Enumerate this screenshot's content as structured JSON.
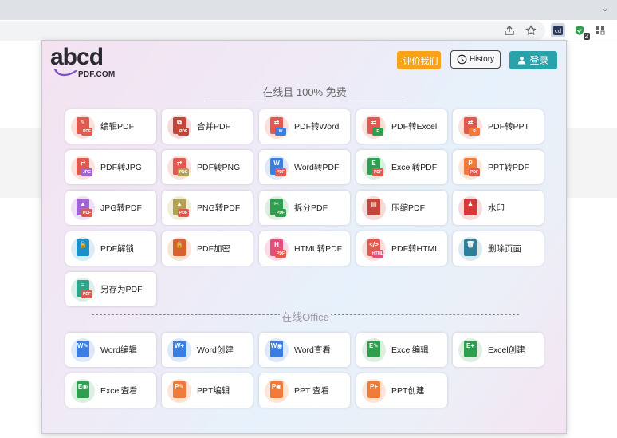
{
  "browser": {
    "extension_badge": "2"
  },
  "header": {
    "logo_text": "abcd",
    "logo_sub": "PDF.COM",
    "rate_label": "·评价我们",
    "history_label": "History",
    "login_label": "登录"
  },
  "tagline": "在线且 100% 免费",
  "office_section_label": "在线Office",
  "pdf_tools": [
    {
      "label": "编辑PDF",
      "icon": "edit-pdf-icon",
      "color": "#e05a4f",
      "tint": "#fbe0dc",
      "tag": "PDF",
      "glyph": "✎"
    },
    {
      "label": "合并PDF",
      "icon": "merge-pdf-icon",
      "color": "#c4453a",
      "tint": "#f6dcd9",
      "tag": "PDF",
      "glyph": "⧉"
    },
    {
      "label": "PDF转Word",
      "icon": "pdf-to-word-icon",
      "color": "#e05a4f",
      "tint": "#fbe0dc",
      "tag": "W",
      "tagColor": "#3b7de0",
      "glyph": "⇄"
    },
    {
      "label": "PDF转Excel",
      "icon": "pdf-to-excel-icon",
      "color": "#e05a4f",
      "tint": "#fbe0dc",
      "tag": "E",
      "tagColor": "#2e9e4f",
      "glyph": "⇄"
    },
    {
      "label": "PDF转PPT",
      "icon": "pdf-to-ppt-icon",
      "color": "#e05a4f",
      "tint": "#fbe0dc",
      "tag": "P",
      "tagColor": "#f07a3a",
      "glyph": "⇄"
    },
    {
      "label": "PDF转JPG",
      "icon": "pdf-to-jpg-icon",
      "color": "#e05a4f",
      "tint": "#fbe0dc",
      "tag": "JPG",
      "tagColor": "#a364d6",
      "glyph": "⇄"
    },
    {
      "label": "PDF转PNG",
      "icon": "pdf-to-png-icon",
      "color": "#e05a4f",
      "tint": "#fbe0dc",
      "tag": "PNG",
      "tagColor": "#b2a253",
      "glyph": "⇄"
    },
    {
      "label": "Word转PDF",
      "icon": "word-to-pdf-icon",
      "color": "#3b7de0",
      "tint": "#dde8fa",
      "tag": "PDF",
      "tagColor": "#e05a4f",
      "glyph": "W"
    },
    {
      "label": "Excel转PDF",
      "icon": "excel-to-pdf-icon",
      "color": "#2e9e4f",
      "tint": "#dcefe1",
      "tag": "PDF",
      "tagColor": "#e05a4f",
      "glyph": "E"
    },
    {
      "label": "PPT转PDF",
      "icon": "ppt-to-pdf-icon",
      "color": "#f07a3a",
      "tint": "#fde6d8",
      "tag": "PDF",
      "tagColor": "#e05a4f",
      "glyph": "P"
    },
    {
      "label": "JPG转PDF",
      "icon": "jpg-to-pdf-icon",
      "color": "#a364d6",
      "tint": "#ede0f7",
      "tag": "PDF",
      "tagColor": "#e05a4f",
      "glyph": "▲"
    },
    {
      "label": "PNG转PDF",
      "icon": "png-to-pdf-icon",
      "color": "#b2a253",
      "tint": "#f1eddb",
      "tag": "PDF",
      "tagColor": "#e05a4f",
      "glyph": "▲"
    },
    {
      "label": "拆分PDF",
      "icon": "split-pdf-icon",
      "color": "#2e9e4f",
      "tint": "#dcefe1",
      "tag": "PDF",
      "tagColor": "#2e9e4f",
      "glyph": "✂"
    },
    {
      "label": "压缩PDF",
      "icon": "compress-pdf-icon",
      "color": "#c4453a",
      "tint": "#f6dcd9",
      "tag": "",
      "glyph": "▤"
    },
    {
      "label": "水印",
      "icon": "watermark-icon",
      "color": "#d93838",
      "tint": "#f8dada",
      "tag": "",
      "glyph": "♟"
    },
    {
      "label": "PDF解锁",
      "icon": "unlock-pdf-icon",
      "color": "#1b8fc7",
      "tint": "#d9ecf7",
      "tag": "",
      "glyph": "🔓"
    },
    {
      "label": "PDF加密",
      "icon": "protect-pdf-icon",
      "color": "#d9612e",
      "tint": "#fae3d8",
      "tag": "",
      "glyph": "🔒"
    },
    {
      "label": "HTML转PDF",
      "icon": "html-to-pdf-icon",
      "color": "#e0507a",
      "tint": "#fadbe5",
      "tag": "PDF",
      "tagColor": "#e05a4f",
      "glyph": "H"
    },
    {
      "label": "PDF转HTML",
      "icon": "pdf-to-html-icon",
      "color": "#e05a4f",
      "tint": "#fbe0dc",
      "tag": "HTML",
      "tagColor": "#e0507a",
      "glyph": "</>"
    },
    {
      "label": "删除页面",
      "icon": "delete-pages-icon",
      "color": "#2f7e9a",
      "tint": "#dbe9ee",
      "tag": "",
      "glyph": "🗑"
    },
    {
      "label": "另存为PDF",
      "icon": "save-as-pdf-icon",
      "color": "#2fa58a",
      "tint": "#dbefe9",
      "tag": "PDF",
      "tagColor": "#e05a4f",
      "glyph": "≡"
    }
  ],
  "office_tools": [
    {
      "label": "Word编辑",
      "icon": "word-edit-icon",
      "color": "#3b7de0",
      "tint": "#dde8fa",
      "tag": "",
      "glyph": "W✎"
    },
    {
      "label": "Word创建",
      "icon": "word-create-icon",
      "color": "#3b7de0",
      "tint": "#dde8fa",
      "tag": "",
      "glyph": "W+"
    },
    {
      "label": "Word查看",
      "icon": "word-view-icon",
      "color": "#3b7de0",
      "tint": "#dde8fa",
      "tag": "",
      "glyph": "W◉"
    },
    {
      "label": "Excel编辑",
      "icon": "excel-edit-icon",
      "color": "#2e9e4f",
      "tint": "#dcefe1",
      "tag": "",
      "glyph": "E✎"
    },
    {
      "label": "Excel创建",
      "icon": "excel-create-icon",
      "color": "#2e9e4f",
      "tint": "#dcefe1",
      "tag": "",
      "glyph": "E+"
    },
    {
      "label": "Excel查看",
      "icon": "excel-view-icon",
      "color": "#2e9e4f",
      "tint": "#dcefe1",
      "tag": "",
      "glyph": "E◉"
    },
    {
      "label": "PPT编辑",
      "icon": "ppt-edit-icon",
      "color": "#f07a3a",
      "tint": "#fde6d8",
      "tag": "",
      "glyph": "P✎"
    },
    {
      "label": "PPT 查看",
      "icon": "ppt-view-icon",
      "color": "#f07a3a",
      "tint": "#fde6d8",
      "tag": "",
      "glyph": "P◉"
    },
    {
      "label": "PPT创建",
      "icon": "ppt-create-icon",
      "color": "#f07a3a",
      "tint": "#fde6d8",
      "tag": "",
      "glyph": "P+"
    }
  ]
}
